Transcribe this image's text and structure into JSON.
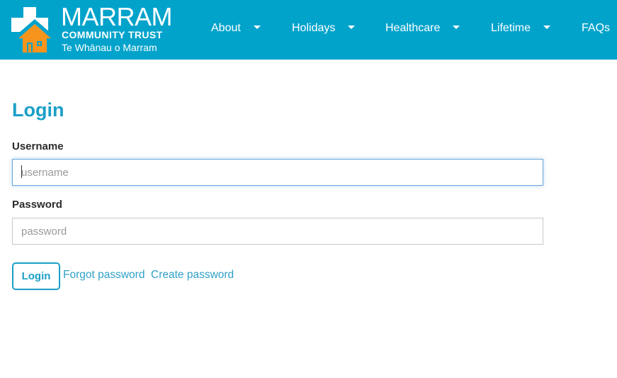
{
  "header": {
    "logo": {
      "title": "MARRAM",
      "subtitle": "COMMUNITY TRUST",
      "tagline": "Te Whānau o Marram",
      "icon": "house-cross-logo-icon"
    },
    "nav": [
      {
        "label": "About",
        "has_dropdown": true
      },
      {
        "label": "Holidays",
        "has_dropdown": true
      },
      {
        "label": "Healthcare",
        "has_dropdown": true
      },
      {
        "label": "Lifetime",
        "has_dropdown": true
      },
      {
        "label": "FAQs",
        "has_dropdown": false
      }
    ]
  },
  "login": {
    "title": "Login",
    "username": {
      "label": "Username",
      "placeholder": "username",
      "value": ""
    },
    "password": {
      "label": "Password",
      "placeholder": "password",
      "value": ""
    },
    "submit_label": "Login",
    "forgot_link": "Forgot password",
    "create_link": "Create password"
  },
  "colors": {
    "header_bg": "#02a3cb",
    "accent": "#1a9fc7",
    "logo_orange": "#f7941d"
  }
}
